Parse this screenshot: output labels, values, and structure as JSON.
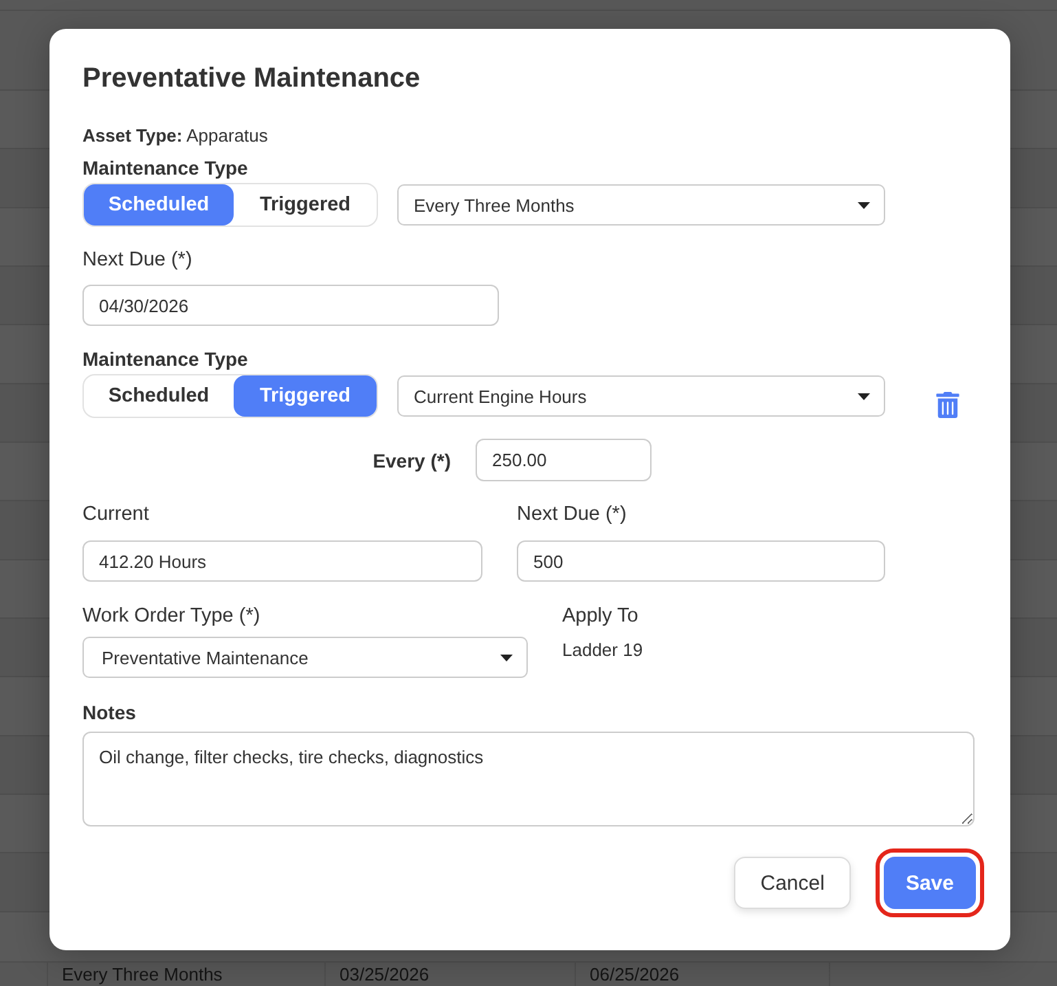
{
  "background_table": {
    "rows": [
      {
        "cells": [
          "Every Three Months",
          "03/25/2026",
          "06/25/2026"
        ]
      }
    ]
  },
  "dialog": {
    "title": "Preventative Maintenance",
    "asset_type": "**Asset Type:** Apparatus",
    "schedules": [
      {
        "kind": "scheduled",
        "label": "Maintenance Type",
        "options": [
          {
            "label": "Scheduled",
            "selected": true
          },
          {
            "label": "Triggered",
            "selected": false
          }
        ],
        "dropdown": "Every Three Months",
        "next_due": {
          "label": "Next Due (*)",
          "value": "04/30/2026"
        }
      },
      {
        "kind": "triggered",
        "label": "Maintenance Type",
        "options": [
          {
            "label": "Scheduled",
            "selected": false
          },
          {
            "label": "Triggered",
            "selected": true
          }
        ],
        "dropdown": "Current Engine Hours",
        "deletable": true,
        "every": {
          "label": "Every (*)",
          "value": "250.00"
        },
        "current": {
          "label": "Current",
          "value": "412.20 Hours"
        },
        "next_due": {
          "label": "Next Due (*)",
          "value": "500"
        }
      }
    ],
    "work_order_type": {
      "label": "Work Order Type (*)",
      "value": "Preventative Maintenance"
    },
    "apply_to": {
      "label": "Apply To",
      "value": "Ladder 19"
    },
    "notes": {
      "label": "Notes",
      "value": "Oil change, filter checks, tire checks, diagnostics"
    },
    "buttons": [
      {
        "label": "Cancel",
        "kind": "secondary",
        "highlighted": false
      },
      {
        "label": "Save",
        "kind": "primary",
        "highlighted": true
      }
    ]
  }
}
